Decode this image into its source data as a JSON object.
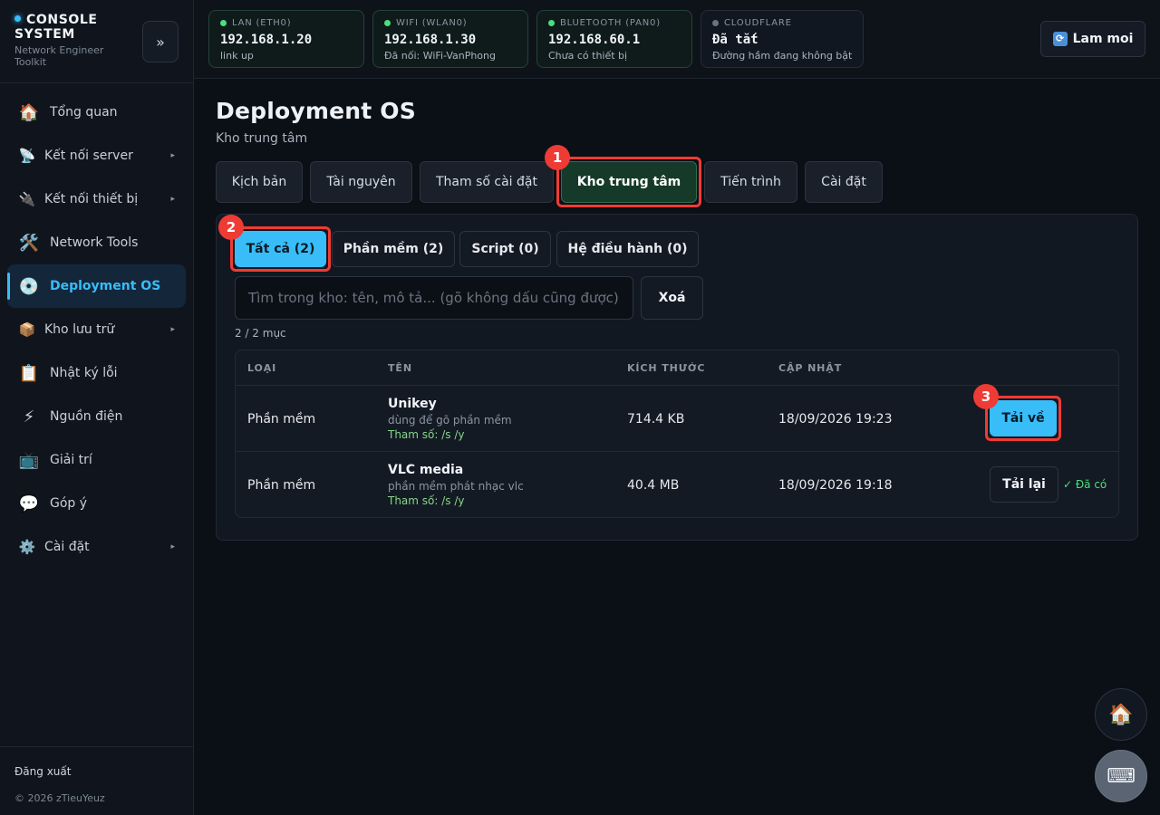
{
  "brand": {
    "title": "CONSOLE SYSTEM",
    "subtitle": "Network Engineer Toolkit",
    "collapse_label": "»"
  },
  "sidebar": {
    "items": [
      {
        "label": "Tổng quan",
        "icon": "🏠"
      },
      {
        "label": "Kết nối server",
        "icon": "📡"
      },
      {
        "label": "Kết nối thiết bị",
        "icon": "🔌"
      },
      {
        "label": "Network Tools",
        "icon": "🛠️"
      },
      {
        "label": "Deployment OS",
        "icon": "💿"
      },
      {
        "label": "Kho lưu trữ",
        "icon": "📦"
      },
      {
        "label": "Nhật ký lỗi",
        "icon": "📋"
      },
      {
        "label": "Nguồn điện",
        "icon": "⚡"
      },
      {
        "label": "Giải trí",
        "icon": "📺"
      },
      {
        "label": "Góp ý",
        "icon": "💬"
      },
      {
        "label": "Cài đặt",
        "icon": "⚙️"
      }
    ],
    "chevron": "▸",
    "logout": "Đăng xuất",
    "copyright": "© 2026 zTieuYeuz"
  },
  "network": [
    {
      "label": "LAN (ETH0)",
      "value": "192.168.1.20",
      "status": "link up"
    },
    {
      "label": "WIFI (WLAN0)",
      "value": "192.168.1.30",
      "status": "Đã nối: WiFi-VanPhong"
    },
    {
      "label": "BLUETOOTH (PAN0)",
      "value": "192.168.60.1",
      "status": "Chưa có thiết bị"
    },
    {
      "label": "CLOUDFLARE",
      "value": "Đã tắt",
      "status": "Đường hầm đang không bật"
    }
  ],
  "topbar": {
    "refresh_icon": "🔃",
    "refresh_label": "Lam moi"
  },
  "page": {
    "title": "Deployment OS",
    "subtitle": "Kho trung tâm"
  },
  "tabs": [
    "Kịch bản",
    "Tài nguyên",
    "Tham số cài đặt",
    "Kho trung tâm",
    "Tiến trình",
    "Cài đặt"
  ],
  "subtabs": [
    "Tất cả (2)",
    "Phần mềm (2)",
    "Script (0)",
    "Hệ điều hành (0)"
  ],
  "search": {
    "placeholder": "Tìm trong kho: tên, mô tả... (gõ không dấu cũng được)",
    "clear_label": "Xoá"
  },
  "count": "2 / 2 mục",
  "table": {
    "headers": [
      "LOẠI",
      "TÊN",
      "KÍCH THƯỚC",
      "CẬP NHẬT"
    ],
    "rows": [
      {
        "type": "Phần mềm",
        "name": "Unikey",
        "desc": "dùng để gõ phần mềm",
        "params": "Tham số: /s /y",
        "size": "714.4 KB",
        "updated": "18/09/2026 19:23",
        "action": "Tải về",
        "note": ""
      },
      {
        "type": "Phần mềm",
        "name": "VLC media",
        "desc": "phần mềm phát nhạc vlc",
        "params": "Tham số: /s /y",
        "size": "40.4 MB",
        "updated": "18/09/2026 19:18",
        "action": "Tải lại",
        "note": "✓ Đã có"
      }
    ]
  },
  "annotations": [
    "1",
    "2",
    "3"
  ],
  "fab": {
    "home_icon": "🏠",
    "keyboard_icon": "⌨"
  },
  "colors": {
    "accent": "#38bdf8",
    "active_tab": "#163a2a",
    "highlight": "#ef3b35",
    "ok": "#4ade80"
  }
}
